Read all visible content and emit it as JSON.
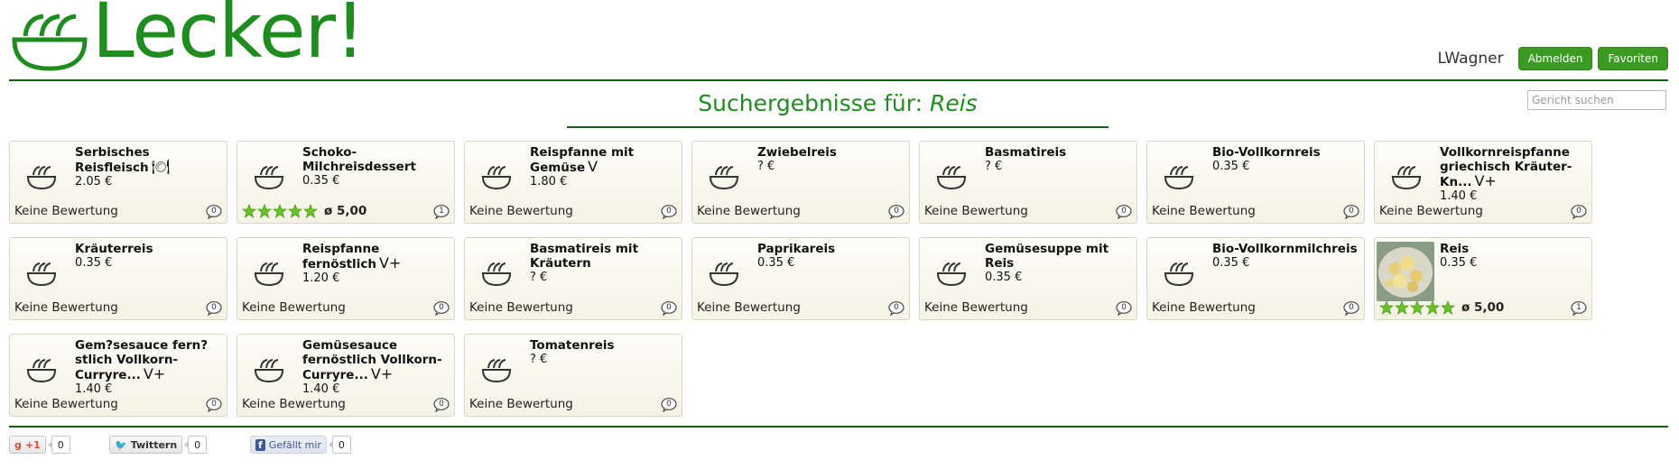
{
  "brand": {
    "name": "Lecker!"
  },
  "user": {
    "name": "LWagner",
    "logout_label": "Abmelden",
    "favorites_label": "Favoriten"
  },
  "search": {
    "title_prefix": "Suchergebnisse für:",
    "query": "Reis",
    "placeholder": "Gericht suchen"
  },
  "results": [
    {
      "name": "Serbisches Reisfleisch",
      "suffix": "🍽",
      "price": "2.05 €",
      "rating": "Keine Bewertung",
      "comments": "0"
    },
    {
      "name": "Schoko-Milchreisdessert",
      "suffix": "",
      "price": "0.35 €",
      "stars": 5,
      "avg": "ø 5,00",
      "comments": "1"
    },
    {
      "name": "Reispfanne mit Gemüse",
      "suffix": "V",
      "price": "1.80 €",
      "rating": "Keine Bewertung",
      "comments": "0"
    },
    {
      "name": "Zwiebelreis",
      "suffix": "",
      "price": "? €",
      "rating": "Keine Bewertung",
      "comments": "0"
    },
    {
      "name": "Basmatireis",
      "suffix": "",
      "price": "? €",
      "rating": "Keine Bewertung",
      "comments": "0"
    },
    {
      "name": "Bio-Vollkornreis",
      "suffix": "",
      "price": "0.35 €",
      "rating": "Keine Bewertung",
      "comments": "0"
    },
    {
      "name": "Vollkornreispfanne griechisch Kräuter-Kn...",
      "suffix": "V+",
      "price": "1.40 €",
      "rating": "Keine Bewertung",
      "comments": "0"
    },
    {
      "name": "Kräuterreis",
      "suffix": "",
      "price": "0.35 €",
      "rating": "Keine Bewertung",
      "comments": "0"
    },
    {
      "name": "Reispfanne fernöstlich",
      "suffix": "V+",
      "price": "1.20 €",
      "rating": "Keine Bewertung",
      "comments": "0"
    },
    {
      "name": "Basmatireis mit Kräutern",
      "suffix": "",
      "price": "? €",
      "rating": "Keine Bewertung",
      "comments": "0"
    },
    {
      "name": "Paprikareis",
      "suffix": "",
      "price": "0.35 €",
      "rating": "Keine Bewertung",
      "comments": "0"
    },
    {
      "name": "Gemüsesuppe mit Reis",
      "suffix": "",
      "price": "0.35 €",
      "rating": "Keine Bewertung",
      "comments": "0"
    },
    {
      "name": "Bio-Vollkornmilchreis",
      "suffix": "",
      "price": "0.35 €",
      "rating": "Keine Bewertung",
      "comments": "0"
    },
    {
      "name": "Reis",
      "suffix": "",
      "price": "0.35 €",
      "stars": 5,
      "avg": "ø 5,00",
      "comments": "1",
      "photo": true
    },
    {
      "name": "Gem?sesauce fern?stlich Vollkorn-Curryre...",
      "suffix": "V+",
      "price": "1.40 €",
      "rating": "Keine Bewertung",
      "comments": "0"
    },
    {
      "name": "Gemüsesauce fernöstlich Vollkorn-Curryre...",
      "suffix": "V+",
      "price": "1.40 €",
      "rating": "Keine Bewertung",
      "comments": "0"
    },
    {
      "name": "Tomatenreis",
      "suffix": "",
      "price": "? €",
      "rating": "Keine Bewertung",
      "comments": "0"
    }
  ],
  "social": {
    "gplus_label": "+1",
    "gplus_count": "0",
    "twitter_label": "Twittern",
    "twitter_count": "0",
    "facebook_label": "Gefällt mir",
    "facebook_count": "0"
  },
  "colors": {
    "brand_green": "#1e8c1e",
    "button_green": "#3a9a22",
    "divider": "#1b5e1b",
    "star_green": "#6cc12a"
  }
}
